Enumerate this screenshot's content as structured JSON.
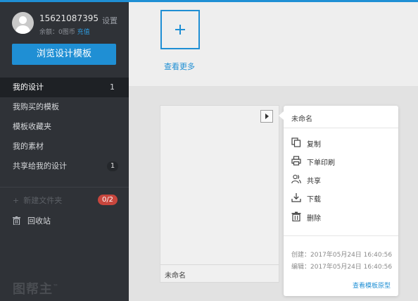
{
  "user": {
    "phone": "15621087395",
    "settings_label": "设置",
    "balance_label": "余额：0图币",
    "recharge_label": "充值"
  },
  "sidebar": {
    "browse_button": "浏览设计模板",
    "items": [
      {
        "label": "我的设计",
        "count": "1"
      },
      {
        "label": "我购买的模板"
      },
      {
        "label": "模板收藏夹"
      },
      {
        "label": "我的素材"
      },
      {
        "label": "共享给我的设计",
        "count": "1"
      }
    ],
    "new_folder_label": "新建文件夹",
    "folder_quota": "0/2",
    "trash_label": "回收站",
    "logo_text": "图帮主",
    "logo_mark": "™"
  },
  "main": {
    "view_more_label": "查看更多",
    "card": {
      "name": "未命名"
    }
  },
  "popup": {
    "title": "未命名",
    "actions": [
      {
        "label": "复制",
        "icon": "copy-icon"
      },
      {
        "label": "下单印刷",
        "icon": "printer-icon"
      },
      {
        "label": "共享",
        "icon": "share-users-icon"
      },
      {
        "label": "下载",
        "icon": "download-icon"
      },
      {
        "label": "删除",
        "icon": "trash-icon"
      }
    ],
    "created": "创建：2017年05月24日 16:40:56",
    "edited": "编辑：2017年05月24日 16:40:56",
    "template_link": "查看模板原型"
  },
  "colors": {
    "accent": "#1f8fd4",
    "sidebar_bg": "#2f3237",
    "badge_red": "#c8463d"
  }
}
